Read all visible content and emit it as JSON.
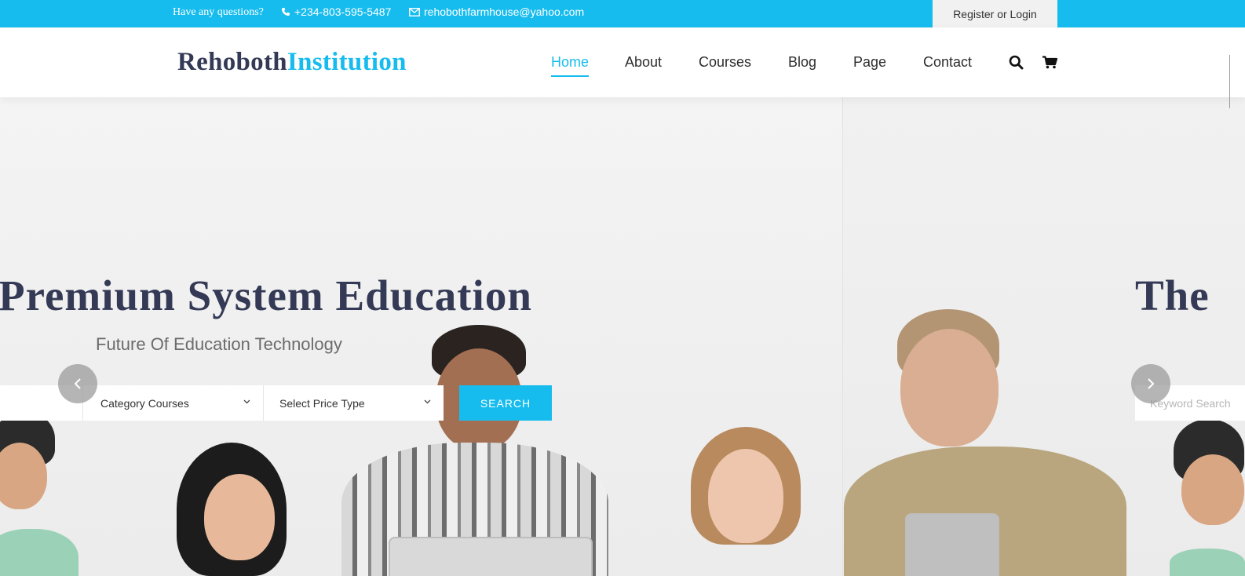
{
  "topbar": {
    "question": "Have any questions?",
    "phone": "+234-803-595-5487",
    "email": "rehobothfarmhouse@yahoo.com",
    "auth": "Register or Login"
  },
  "logo": {
    "part1": "Rehoboth",
    "part2": "Institution"
  },
  "nav": {
    "items": [
      {
        "label": "Home",
        "active": true
      },
      {
        "label": "About"
      },
      {
        "label": "Courses"
      },
      {
        "label": "Blog"
      },
      {
        "label": "Page"
      },
      {
        "label": "Contact"
      }
    ],
    "icons": [
      "search-icon",
      "cart-icon"
    ]
  },
  "hero": {
    "title": "Premium System Education",
    "subtitle": "Future Of Education Technology",
    "next_title": "The",
    "search": {
      "category": "Category Courses",
      "price": "Select Price Type",
      "button": "SEARCH",
      "keyword_placeholder": "Keyword Search"
    },
    "arrows": [
      "chevron-left-icon",
      "chevron-right-icon"
    ]
  },
  "colors": {
    "accent": "#17bcee",
    "dark": "#343a55",
    "topbar": "#17bcee"
  }
}
